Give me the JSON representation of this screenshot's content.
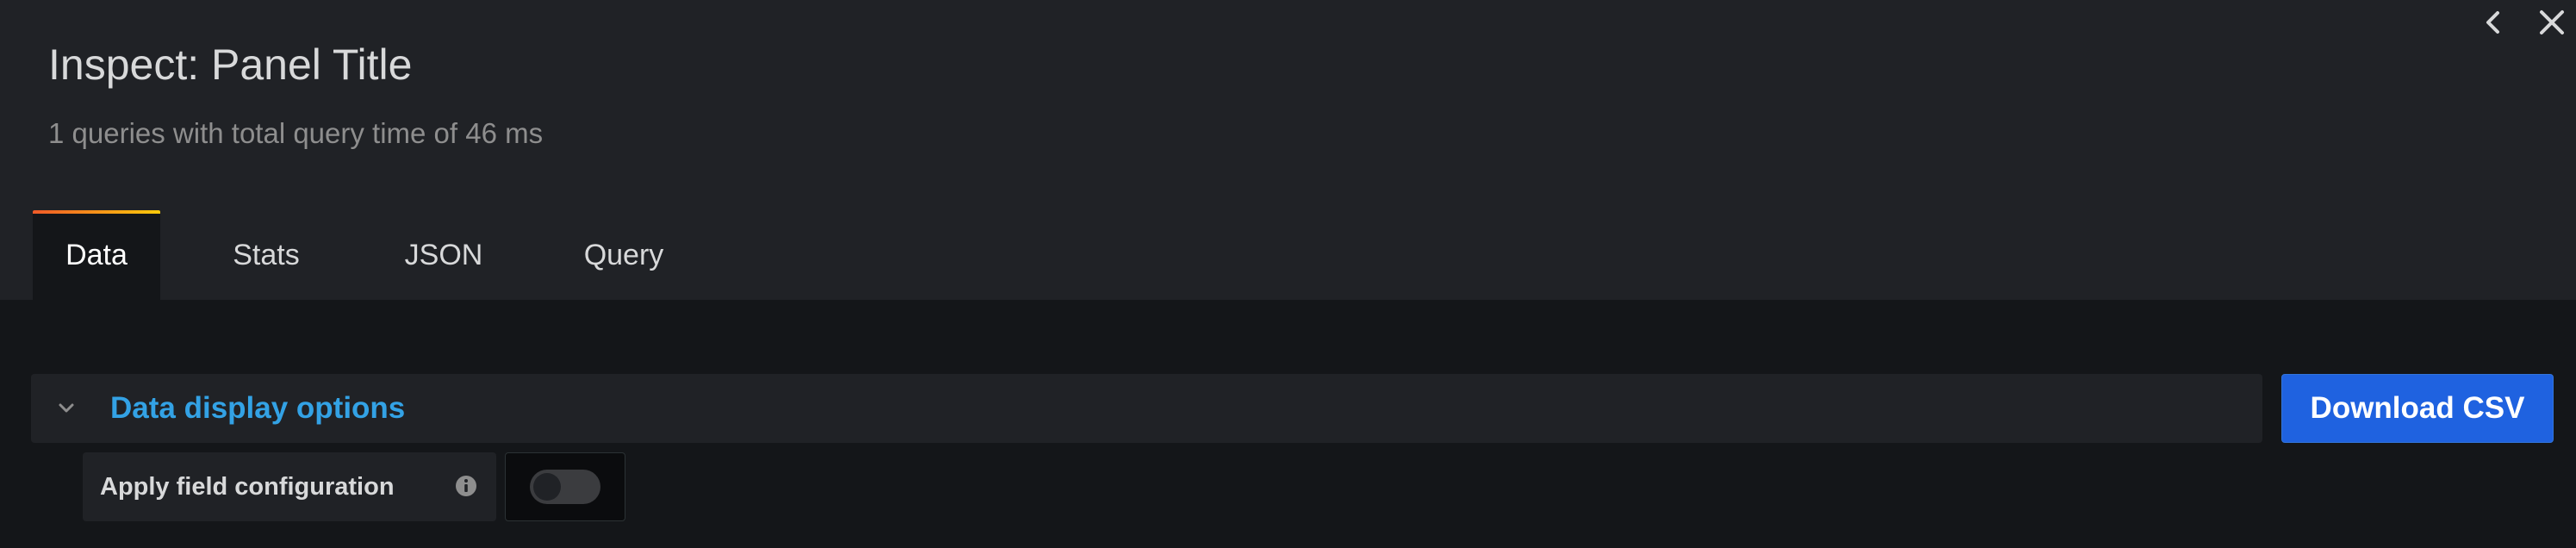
{
  "header": {
    "title": "Inspect: Panel Title",
    "subtitle": "1 queries with total query time of 46 ms"
  },
  "controls": {
    "back_icon": "chevron-left-icon",
    "close_icon": "close-icon"
  },
  "tabs": [
    {
      "label": "Data",
      "active": true
    },
    {
      "label": "Stats",
      "active": false
    },
    {
      "label": "JSON",
      "active": false
    },
    {
      "label": "Query",
      "active": false
    }
  ],
  "data_options": {
    "label": "Data display options",
    "expanded": true,
    "fields": [
      {
        "label": "Apply field configuration",
        "info_icon": "info-icon",
        "toggle_on": false
      }
    ]
  },
  "actions": {
    "download_label": "Download CSV"
  },
  "colors": {
    "accent_link": "#33a2e5",
    "primary_button": "#1f62e0",
    "tab_gradient_start": "#f05a28",
    "tab_gradient_end": "#fbca0a"
  }
}
